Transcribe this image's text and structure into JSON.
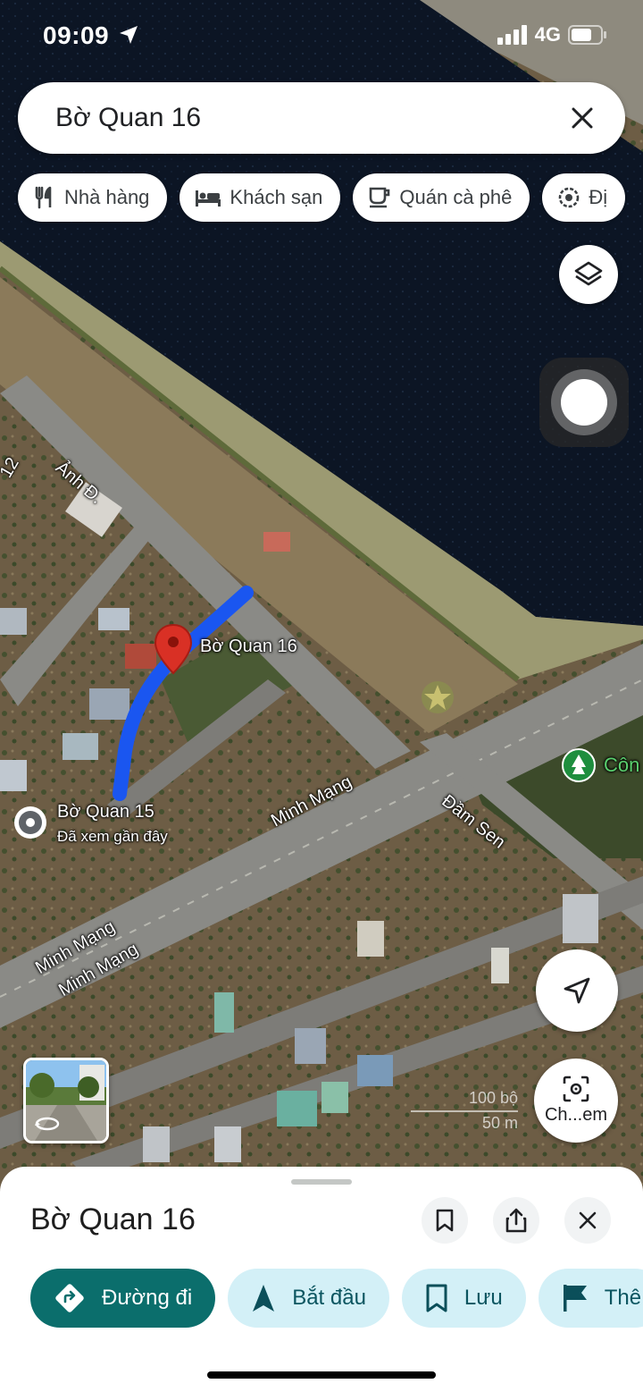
{
  "status_bar": {
    "time": "09:09",
    "network": "4G"
  },
  "search": {
    "query": "Bờ Quan 16"
  },
  "chips": [
    {
      "icon": "restaurant-icon",
      "label": "Nhà hàng"
    },
    {
      "icon": "hotel-icon",
      "label": "Khách sạn"
    },
    {
      "icon": "coffee-icon",
      "label": "Quán cà phê"
    },
    {
      "icon": "attraction-icon",
      "label": "Đị"
    }
  ],
  "map": {
    "selected_pin_label": "Bờ Quan 16",
    "recent_place": {
      "name": "Bờ Quan 15",
      "note": "Đã xem gần đây"
    },
    "park_label": "Côn",
    "streets": {
      "anh_d": "Ảnh Đ.",
      "num_12": "12",
      "minh_mang_main": "Minh Mạng",
      "minh_mang_lower_1": "Minh Mạng",
      "minh_mang_lower_2": "Minh Mạng",
      "dam_sen": "Đầm Sen"
    },
    "scale": {
      "imperial": "100 bộ",
      "metric": "50 m"
    },
    "colors": {
      "route": "#1a56f0",
      "pin": "#d93025",
      "park_pin": "#1e8e3e"
    }
  },
  "controls": {
    "layers_icon": "layers-icon",
    "location_icon": "navigation-arrow-icon",
    "lens_label": "Ch...em"
  },
  "sheet": {
    "title": "Bờ Quan 16",
    "actions": [
      {
        "label": "Đường đi",
        "icon": "directions-icon"
      },
      {
        "label": "Bắt đầu",
        "icon": "navigation-icon"
      },
      {
        "label": "Lưu",
        "icon": "bookmark-icon"
      },
      {
        "label": "Thê",
        "icon": "flag-icon"
      }
    ]
  }
}
